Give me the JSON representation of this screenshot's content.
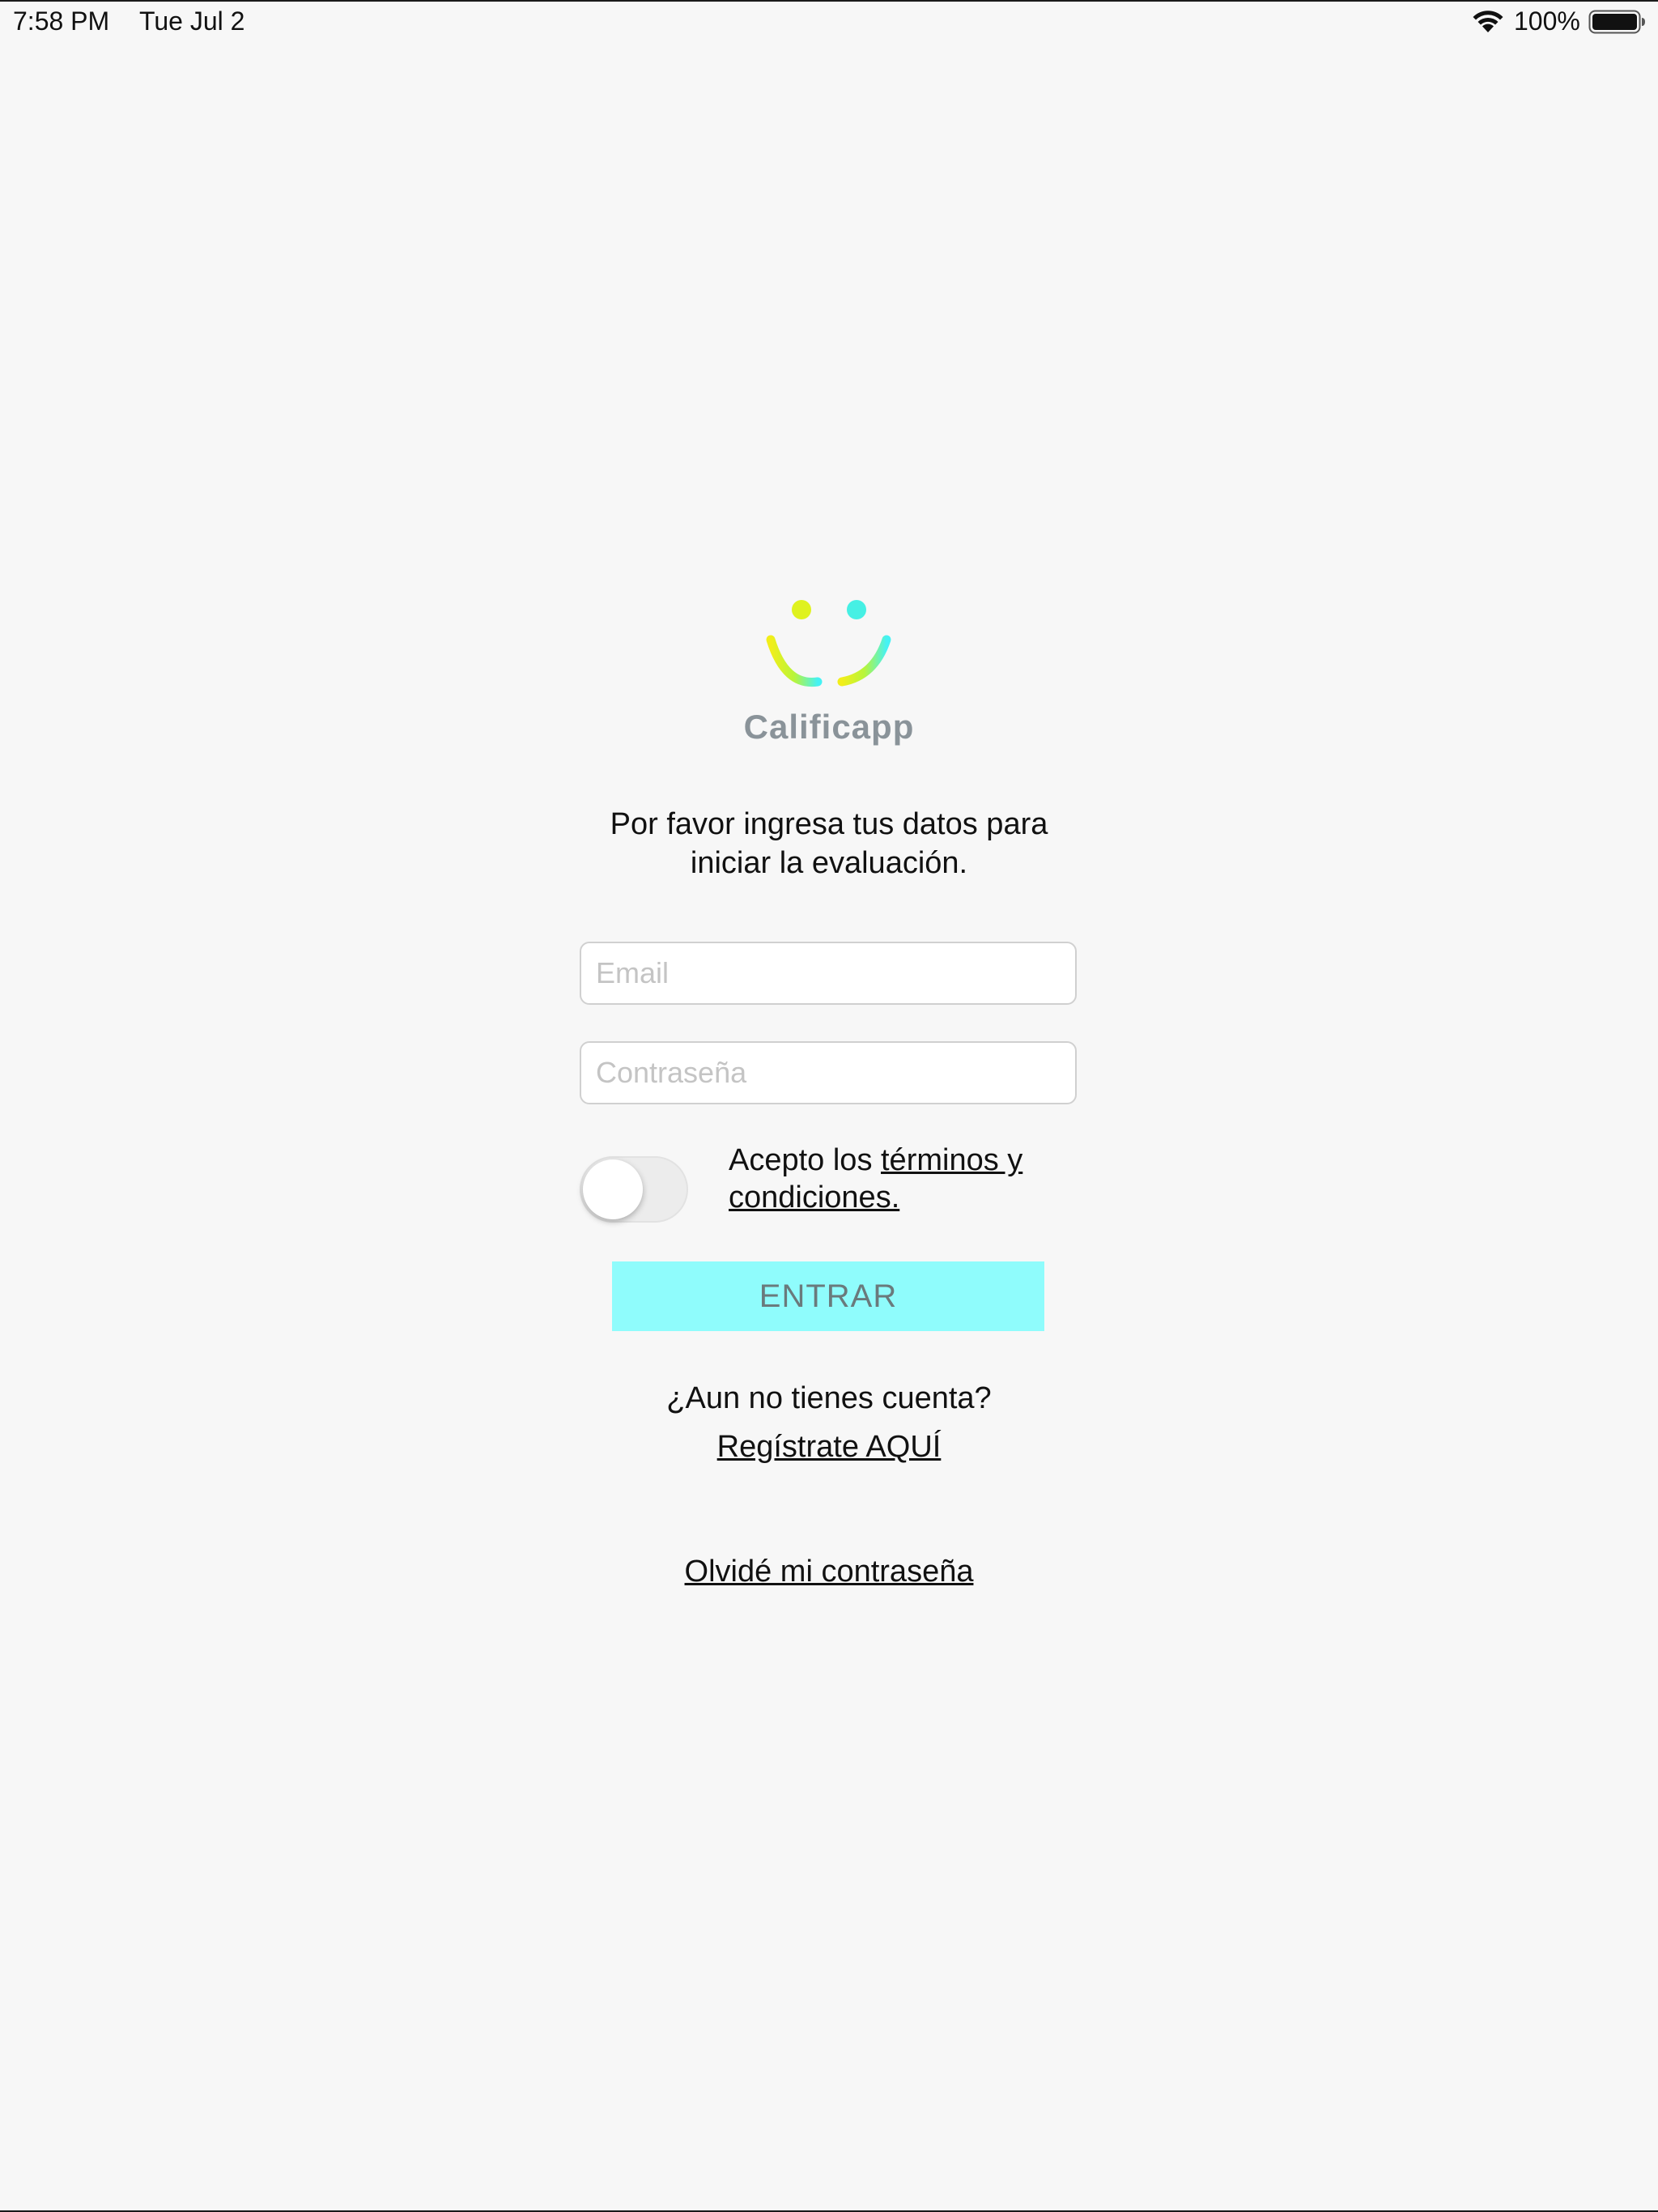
{
  "status_bar": {
    "time": "7:58 PM",
    "date": "Tue Jul 2",
    "battery_text": "100%",
    "wifi_icon": "wifi-icon",
    "battery_icon": "battery-icon"
  },
  "brand": {
    "name": "Calificapp",
    "logo_icon": "smiley-logo-icon",
    "colors": {
      "yellow": "#e8f21a",
      "cyan": "#4ff5f0",
      "text": "#8a9399"
    }
  },
  "intro": {
    "line1": "Por favor ingresa tus datos para",
    "line2": "iniciar la evaluación."
  },
  "form": {
    "email_placeholder": "Email",
    "password_placeholder": "Contraseña",
    "terms_prefix": "Acepto los ",
    "terms_link_line1": "términos y",
    "terms_link_line2": "condiciones.",
    "terms_toggle_on": false,
    "enter_label": "ENTRAR",
    "enter_color": "#8ffcfc"
  },
  "footer": {
    "no_account": "¿Aun no tienes cuenta?",
    "register_link": "Regístrate AQUÍ",
    "forgot_link": "Olvidé mi contraseña"
  }
}
